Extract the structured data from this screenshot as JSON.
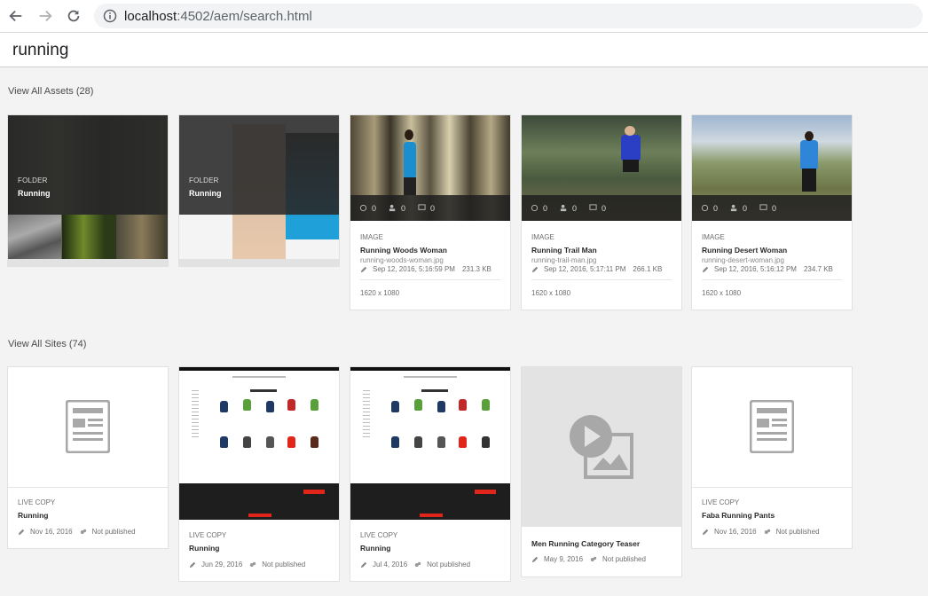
{
  "browser": {
    "url_host": "localhost",
    "url_rest": ":4502/aem/search.html"
  },
  "search": {
    "query": "running"
  },
  "assets": {
    "header": "View All Assets (28)",
    "folders": [
      {
        "type": "FOLDER",
        "name": "Running"
      },
      {
        "type": "FOLDER",
        "name": "Running"
      }
    ],
    "images": [
      {
        "type": "IMAGE",
        "title": "Running Woods Woman",
        "file": "running-woods-woman.jpg",
        "date": "Sep 12, 2016, 5:16:59 PM",
        "size": "231.3 KB",
        "dims": "1620 x 1080",
        "stats": [
          "0",
          "0",
          "0"
        ]
      },
      {
        "type": "IMAGE",
        "title": "Running Trail Man",
        "file": "running-trail-man.jpg",
        "date": "Sep 12, 2016, 5:17:11 PM",
        "size": "266.1 KB",
        "dims": "1620 x 1080",
        "stats": [
          "0",
          "0",
          "0"
        ]
      },
      {
        "type": "IMAGE",
        "title": "Running Desert Woman",
        "file": "running-desert-woman.jpg",
        "date": "Sep 12, 2016, 5:16:12 PM",
        "size": "234.7 KB",
        "dims": "1620 x 1080",
        "stats": [
          "0",
          "0",
          "0"
        ]
      }
    ]
  },
  "sites": {
    "header": "View All Sites (74)",
    "items": [
      {
        "type": "LIVE COPY",
        "title": "Running",
        "date": "Nov 16, 2016",
        "status": "Not published"
      },
      {
        "type": "LIVE COPY",
        "title": "Running",
        "date": "Jun 29, 2016",
        "status": "Not published"
      },
      {
        "type": "LIVE COPY",
        "title": "Running",
        "date": "Jul 4, 2016",
        "status": "Not published"
      },
      {
        "type": "",
        "title": "Men Running Category Teaser",
        "date": "May 9, 2016",
        "status": "Not published"
      },
      {
        "type": "LIVE COPY",
        "title": "Faba Running Pants",
        "date": "Nov 16, 2016",
        "status": "Not published"
      }
    ]
  },
  "colors": {
    "accent_red": "#e1251b",
    "dark_overlay": "#282828",
    "placeholder_gray": "#a8a8a8"
  }
}
